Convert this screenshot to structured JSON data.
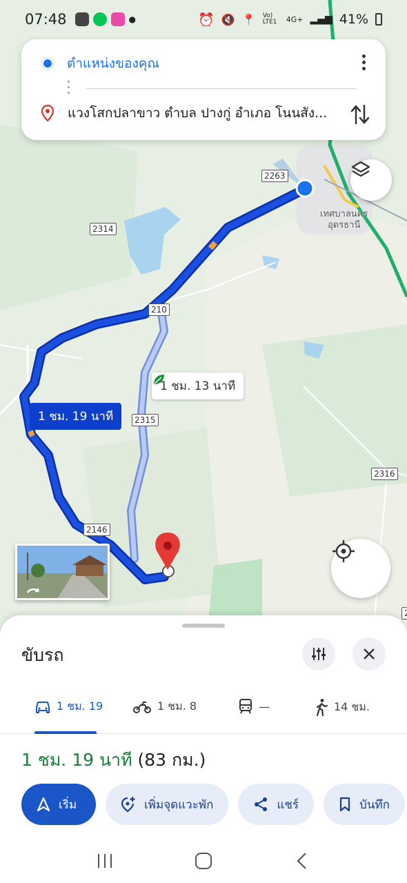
{
  "status_bar": {
    "time": "07:48",
    "network": "Vo) LTE1",
    "network_type": "4G+",
    "battery": "41%"
  },
  "search": {
    "origin": "ตำแหน่งของคุณ",
    "destination": "แวงโสกปลาขาว ตำบล ปางกู่ อำเภอ โนนสัง..."
  },
  "map": {
    "road_shields": [
      "2263",
      "2314",
      "210",
      "2315",
      "2146",
      "2316",
      "2"
    ],
    "place_label_line1": "เทศบาลนคร",
    "place_label_line2": "อุดรธานี",
    "main_route_label": "1 ชม. 19 นาที",
    "alt_route_label": "1 ชม. 13 นาที",
    "main_route_color": "#0d3fcc",
    "alt_route_color": "#8fa8e8"
  },
  "sheet": {
    "title": "ขับรถ",
    "modes": [
      {
        "icon": "car-icon",
        "label": "1 ชม. 19"
      },
      {
        "icon": "motorcycle-icon",
        "label": "1 ชม. 8"
      },
      {
        "icon": "train-icon",
        "label": "—"
      },
      {
        "icon": "walk-icon",
        "label": "14 ชม."
      }
    ],
    "summary_duration": "1 ชม. 19 นาที",
    "summary_distance": "(83 กม.)",
    "actions": {
      "start": "เริ่ม",
      "add_stop": "เพิ่มจุดแวะพัก",
      "share": "แชร์",
      "save": "บันทึก"
    }
  }
}
